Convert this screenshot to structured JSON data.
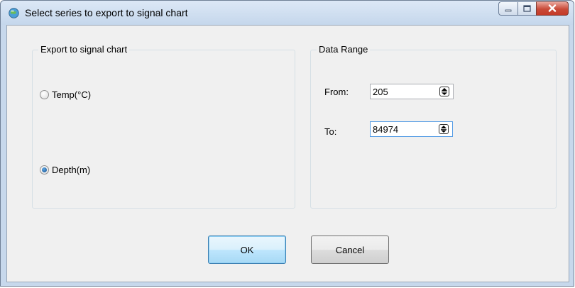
{
  "window": {
    "title": "Select series to export to signal chart",
    "icon": "globe-icon",
    "controls": [
      "minimize-icon",
      "maximize-icon",
      "close-icon"
    ]
  },
  "export_group": {
    "label": "Export to signal chart",
    "options": [
      {
        "label": "Temp(°C)",
        "selected": false
      },
      {
        "label": "Depth(m)",
        "selected": true
      }
    ]
  },
  "range_group": {
    "label": "Data Range",
    "from_label": "From:",
    "from_value": "205",
    "to_label": "To:",
    "to_value": "84974"
  },
  "buttons": {
    "ok": "OK",
    "cancel": "Cancel"
  },
  "colors": {
    "titlebar": "#c7d8ec",
    "client": "#f0f0f0",
    "radio_selected": "#124f8e",
    "close_button": "#c94a38",
    "default_button": "#3c7fb1"
  }
}
